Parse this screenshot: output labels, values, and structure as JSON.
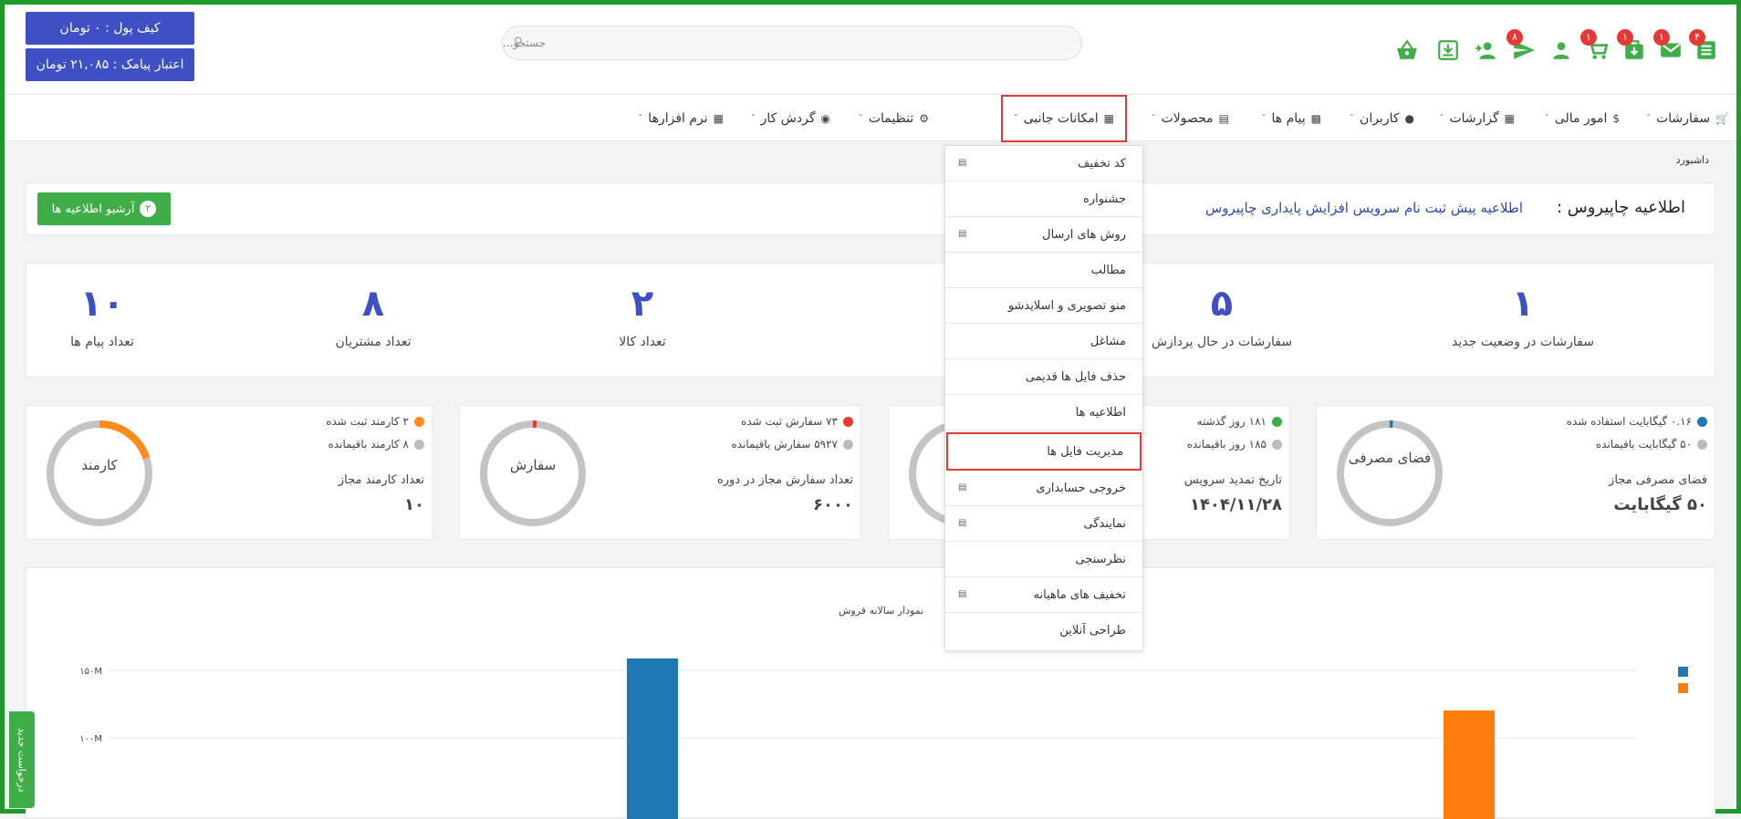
{
  "wallet": {
    "wallet_balance": "کیف پول : ۰ تومان",
    "sms_credit": "اعتبار پیامک : ۲۱,۰۸۵ تومان"
  },
  "search": {
    "placeholder": "جستجو..."
  },
  "top_icons": [
    {
      "icon": "list-icon",
      "badge": "۴"
    },
    {
      "icon": "mail-icon",
      "badge": "۱"
    },
    {
      "icon": "download-bag-icon",
      "badge": "۱"
    },
    {
      "icon": "cart-icon",
      "badge": "۱"
    },
    {
      "icon": "user-icon",
      "badge": ""
    },
    {
      "icon": "send-icon",
      "badge": "۸"
    },
    {
      "icon": "add-user-icon",
      "badge": ""
    },
    {
      "icon": "download-box-icon",
      "badge": ""
    },
    {
      "icon": "basket-icon",
      "badge": ""
    }
  ],
  "colors": {
    "accent": "#3f4fc4",
    "green": "#3fae48",
    "highlight": "#e53935",
    "bar_blue": "#1f77b4",
    "bar_orange": "#ff7f0e"
  },
  "nav": {
    "items": [
      {
        "label": "سفارشات",
        "icon": "cart-icon"
      },
      {
        "label": "امور مالی",
        "icon": "dollar-icon"
      },
      {
        "label": "گزارشات",
        "icon": "chart-icon"
      },
      {
        "label": "کاربران",
        "icon": "user-icon"
      },
      {
        "label": "پیام ها",
        "icon": "chat-icon"
      },
      {
        "label": "محصولات",
        "icon": "store-icon"
      },
      {
        "label": "امکانات جانبی",
        "icon": "grid-icon"
      },
      {
        "label": "تنظیمات",
        "icon": "gear-icon"
      },
      {
        "label": "گردش کار",
        "icon": "globe-icon"
      },
      {
        "label": "نرم افزارها",
        "icon": "apps-icon"
      }
    ]
  },
  "breadcrumb": "داشبورد",
  "notice": {
    "title": "اطلاعیه چاپیروس :",
    "link": "اطلاعیه پیش ثبت نام سرویس افزایش پایداری چاپیروس",
    "archive_label": "آرشیو اطلاعیه ها",
    "archive_count": "۲"
  },
  "stats": [
    {
      "value": "۱",
      "label": "سفارشات در وضعیت جدید"
    },
    {
      "value": "۵",
      "label": "سفارشات در حال پردازش"
    },
    {
      "value": "۲",
      "label": "تعداد کالا"
    },
    {
      "value": "۸",
      "label": "تعداد مشتریان"
    },
    {
      "value": "۱۰",
      "label": "تعداد پیام ها"
    }
  ],
  "storage_card": {
    "ring_label": "فضای مصرفی",
    "used_fraction": 0.0032,
    "legend_used": "۰.۱۶ گیگابایت استفاده شده",
    "legend_remaining": "۵۰ گیگابایت باقیمانده",
    "title": "فضای مصرفی مجاز",
    "value": "۵۰ گیگابایت"
  },
  "service_card": {
    "legend_used": "۱۸۱ روز گذشته",
    "legend_remaining": "۱۸۵ روز باقیمانده",
    "title": "تاریخ تمدید سرویس",
    "value": "۱۴۰۴/۱۱/۲۸"
  },
  "orders_card": {
    "ring_label": "سفارش",
    "used_fraction": 0.012,
    "legend_used": "۷۳ سفارش ثبت شده",
    "legend_remaining": "۵۹۲۷ سفارش باقیمانده",
    "title": "تعداد سفارش مجاز در دوره",
    "value": "۶۰۰۰"
  },
  "staff_card": {
    "ring_label": "کارمند",
    "used_fraction": 0.2,
    "legend_used": "۲ کارمند ثبت شده",
    "legend_remaining": "۸ کارمند باقیمانده",
    "title": "تعداد کارمند مجاز",
    "value": "۱۰"
  },
  "dropdown": {
    "items": [
      {
        "label": "کد تخفیف",
        "has_icon": true
      },
      {
        "label": "جشنواره",
        "has_icon": false
      },
      {
        "label": "روش های ارسال",
        "has_icon": true
      },
      {
        "label": "مطالب",
        "has_icon": false
      },
      {
        "label": "منو تصویری و اسلایدشو",
        "has_icon": false
      },
      {
        "label": "مشاغل",
        "has_icon": false
      },
      {
        "label": "حذف فایل ها قدیمی",
        "has_icon": false
      },
      {
        "label": "اطلاعیه ها",
        "has_icon": false
      },
      {
        "label": "مدیریت فایل ها",
        "has_icon": false
      },
      {
        "label": "خروجی حسابداری",
        "has_icon": true
      },
      {
        "label": "نمایندگی",
        "has_icon": true
      },
      {
        "label": "نظرسنجی",
        "has_icon": false
      },
      {
        "label": "تخفیف های ماهیانه",
        "has_icon": true
      },
      {
        "label": "طراحی آنلاین",
        "has_icon": false
      }
    ]
  },
  "side_tab": "درخواست جدید",
  "chart_data": {
    "type": "bar",
    "title": "نمودار سالانه فروش",
    "y_ticks": [
      "۱۰۰M",
      "۱۵۰M"
    ],
    "series": [
      {
        "color": "#1f77b4",
        "values": [
          176
        ]
      },
      {
        "color": "#ff7f0e",
        "values": [
          119
        ]
      }
    ]
  }
}
